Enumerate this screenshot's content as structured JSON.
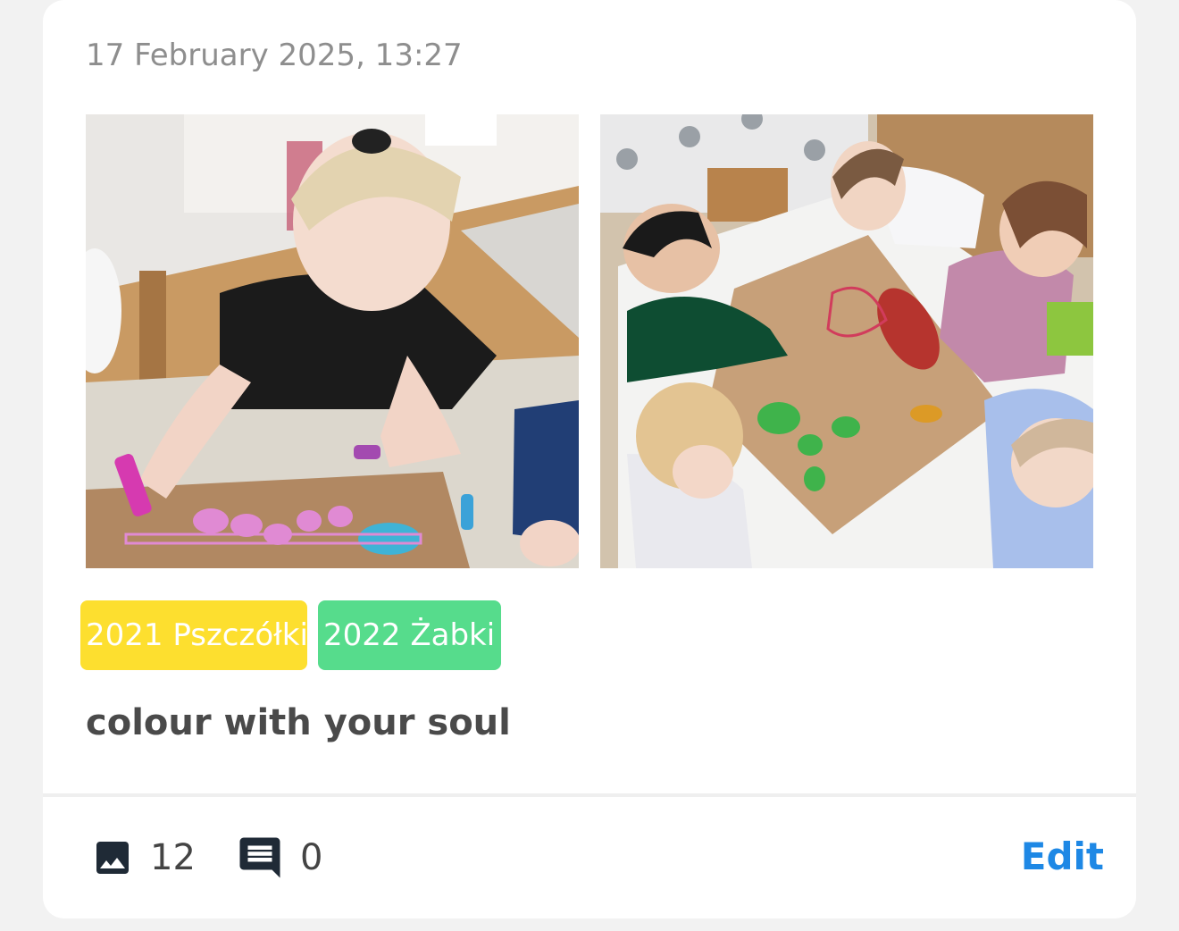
{
  "post": {
    "date": "17 February 2025, 13:27",
    "photos": [
      {
        "name": "girl-coloring-photo"
      },
      {
        "name": "children-painting-photo"
      }
    ],
    "tags": [
      {
        "label": "2021 Pszczółki",
        "color": "#fddf2f"
      },
      {
        "label": "2022 Żabki",
        "color": "#56dc8c"
      }
    ],
    "caption": "colour with your soul"
  },
  "footer": {
    "photos_icon": "image-icon",
    "photo_count": "12",
    "comments_icon": "comment-icon",
    "comment_count": "0",
    "edit_label": "Edit"
  },
  "colors": {
    "accent": "#1e88e5",
    "icon": "#1f2a36"
  }
}
